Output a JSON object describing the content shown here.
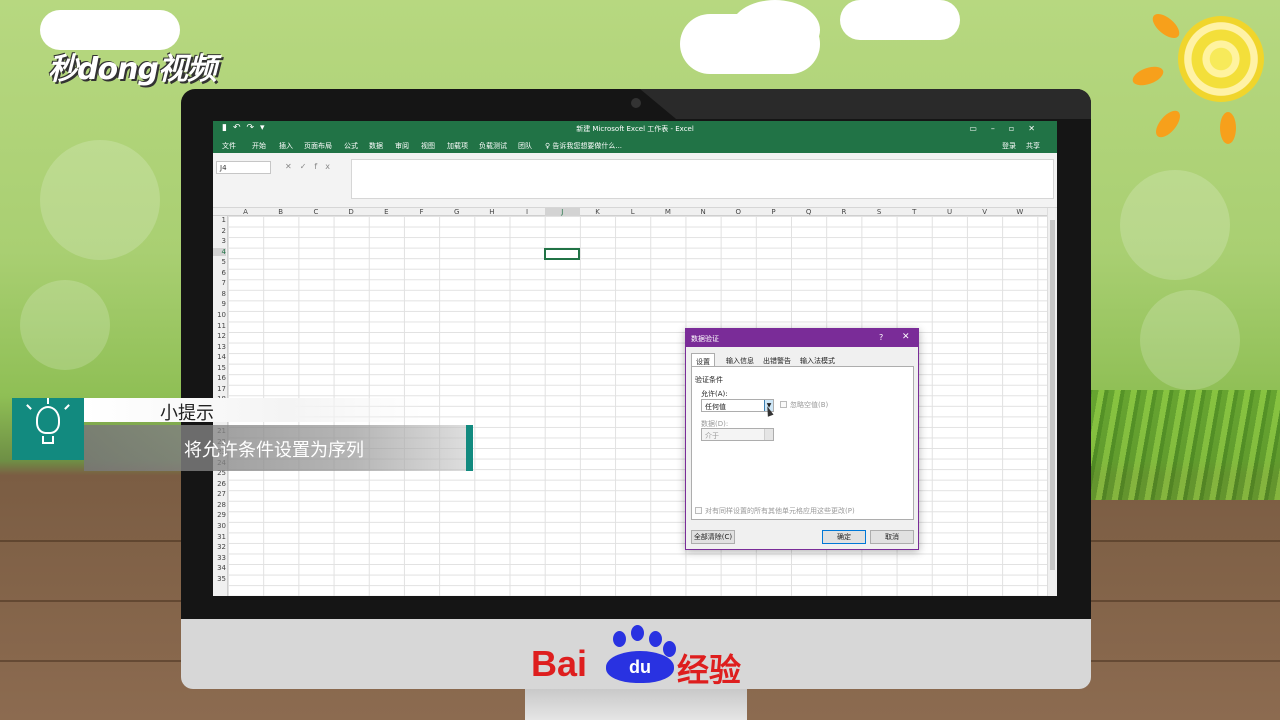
{
  "brand": {
    "watermark": "秒dong视频"
  },
  "excel": {
    "window_title": "新建 Microsoft Excel 工作表 - Excel",
    "quick_access": [
      "▮",
      "↶",
      "↷",
      "▾"
    ],
    "window_buttons": [
      "▭",
      "–",
      "▫",
      "✕"
    ],
    "menu": [
      "文件",
      "开始",
      "插入",
      "页面布局",
      "公式",
      "数据",
      "审阅",
      "视图",
      "加载项",
      "负载测试",
      "团队"
    ],
    "tell_me": "♀ 告诉我您想要做什么...",
    "login": "登录",
    "share": "共享",
    "namebox": "J4",
    "fx_label": "fx",
    "columns": [
      "A",
      "B",
      "C",
      "D",
      "E",
      "F",
      "G",
      "H",
      "I",
      "J",
      "K",
      "L",
      "M",
      "N",
      "O",
      "P",
      "Q",
      "R",
      "S",
      "T",
      "U",
      "V",
      "W"
    ],
    "rows": [
      "1",
      "2",
      "3",
      "4",
      "5",
      "6",
      "7",
      "8",
      "9",
      "10",
      "11",
      "12",
      "13",
      "14",
      "15",
      "16",
      "17",
      "18",
      "19",
      "20",
      "21",
      "22",
      "23",
      "24",
      "25",
      "26",
      "27",
      "28",
      "29",
      "30",
      "31",
      "32",
      "33",
      "34",
      "35"
    ],
    "selected_cell": "J4"
  },
  "dialog": {
    "title": "数据验证",
    "help": "?",
    "close": "✕",
    "tabs": [
      "设置",
      "输入信息",
      "出错警告",
      "输入法模式"
    ],
    "active_tab": "设置",
    "section_label": "验证条件",
    "allow_label": "允许(A):",
    "allow_value": "任何值",
    "ignore_blank": "忽略空值(B)",
    "data_label": "数据(D):",
    "data_value": "介于",
    "apply_all": "对有同样设置的所有其他单元格应用这些更改(P)",
    "clear_all": "全部清除(C)",
    "ok": "确定",
    "cancel": "取消"
  },
  "tip": {
    "heading": "小提示",
    "text": "将允许条件设置为序列"
  },
  "baidu": {
    "bai": "Bai",
    "du": "du",
    "jingyan": "经验"
  }
}
